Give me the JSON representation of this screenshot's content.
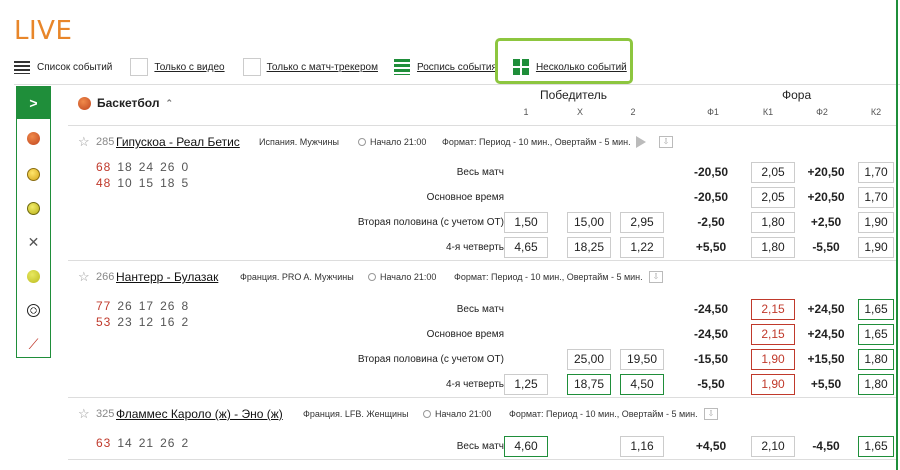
{
  "header": {
    "title": "LIVE"
  },
  "modes": [
    {
      "label": "Список событий",
      "icon": "list-icon"
    },
    {
      "label": "Только с видео",
      "icon": "checkbox"
    },
    {
      "label": "Только с матч-трекером",
      "icon": "checkbox"
    },
    {
      "label": "Роспись события",
      "icon": "rows-icon"
    },
    {
      "label": "Несколько событий",
      "icon": "grid-icon"
    }
  ],
  "sidebar": {
    "toggle": ">",
    "items": [
      "basketball-icon",
      "tennis-icon",
      "volleyball-icon",
      "hockey-icon",
      "tennis-ball-icon",
      "football-icon",
      "table-tennis-icon"
    ]
  },
  "sport": {
    "name": "Баскетбол",
    "chev": "⌃",
    "groups": {
      "winner": "Победитель",
      "handicap": "Фора"
    },
    "subs": [
      "1",
      "X",
      "2",
      "Ф1",
      "К1",
      "Ф2",
      "К2"
    ]
  },
  "events": [
    {
      "num": "285",
      "name": "Гипускоа - Реал Бетис",
      "country": "Испания. Мужчины",
      "start": "Начало 21:00",
      "format": "Формат: Период - 10 мин., Овертайм - 5 мин.",
      "scores": [
        [
          "68",
          "18",
          "24",
          "26",
          "0"
        ],
        [
          "48",
          "10",
          "15",
          "18",
          "5"
        ]
      ],
      "rows": [
        {
          "label": "Весь матч",
          "w1": "",
          "x": "",
          "w2": "",
          "f1": "-20,50",
          "k1": "2,05",
          "f2": "+20,50",
          "k2": "1,70"
        },
        {
          "label": "Основное время",
          "w1": "",
          "x": "",
          "w2": "",
          "f1": "-20,50",
          "k1": "2,05",
          "f2": "+20,50",
          "k2": "1,70"
        },
        {
          "label": "Вторая половина (с учетом ОТ)",
          "w1": "1,50",
          "x": "15,00",
          "w2": "2,95",
          "f1": "-2,50",
          "k1": "1,80",
          "f2": "+2,50",
          "k2": "1,90"
        },
        {
          "label": "4-я четверть",
          "w1": "4,65",
          "x": "18,25",
          "w2": "1,22",
          "f1": "+5,50",
          "k1": "1,80",
          "f2": "-5,50",
          "k2": "1,90"
        }
      ]
    },
    {
      "num": "266",
      "name": "Нантерр - Булазак",
      "country": "Франция. PRO A. Мужчины",
      "start": "Начало 21:00",
      "format": "Формат: Период - 10 мин., Овертайм - 5 мин.",
      "scores": [
        [
          "77",
          "26",
          "17",
          "26",
          "8"
        ],
        [
          "53",
          "23",
          "12",
          "16",
          "2"
        ]
      ],
      "rows": [
        {
          "label": "Весь матч",
          "w1": "",
          "x": "",
          "w2": "",
          "f1": "-24,50",
          "k1": "2,15",
          "f2": "+24,50",
          "k2": "1,65"
        },
        {
          "label": "Основное время",
          "w1": "",
          "x": "",
          "w2": "",
          "f1": "-24,50",
          "k1": "2,15",
          "f2": "+24,50",
          "k2": "1,65"
        },
        {
          "label": "Вторая половина (с учетом ОТ)",
          "w1": "",
          "x": "25,00",
          "w2": "19,50",
          "f1": "-15,50",
          "k1": "1,90",
          "f2": "+15,50",
          "k2": "1,80"
        },
        {
          "label": "4-я четверть",
          "w1": "1,25",
          "x": "18,75",
          "w2": "4,50",
          "f1": "-5,50",
          "k1": "1,90",
          "f2": "+5,50",
          "k2": "1,80"
        }
      ]
    },
    {
      "num": "325",
      "name": "Фламмес Кароло (ж) - Эно (ж)",
      "country": "Франция. LFB. Женщины",
      "start": "Начало 21:00",
      "format": "Формат: Период - 10 мин., Овертайм - 5 мин.",
      "scores": [
        [
          "63",
          "14",
          "21",
          "26",
          "2"
        ]
      ],
      "rows": [
        {
          "label": "Весь матч",
          "w1": "4,60",
          "x": "",
          "w2": "1,16",
          "f1": "+4,50",
          "k1": "2,10",
          "f2": "-4,50",
          "k2": "1,65"
        }
      ]
    }
  ],
  "colors": {
    "accent": "#1f8e3a",
    "live": "#e8862a",
    "highlight": "#8dc63f",
    "down": "#c0392b"
  }
}
